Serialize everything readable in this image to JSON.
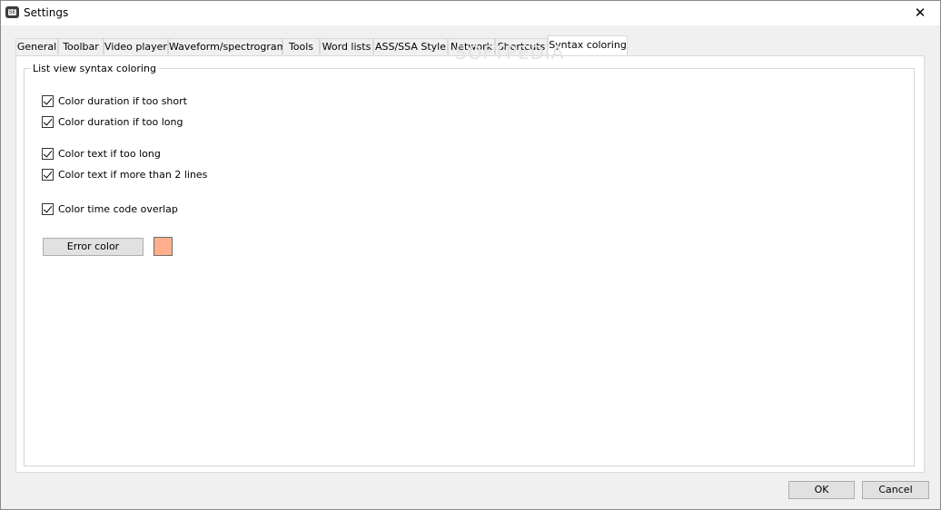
{
  "window": {
    "title": "Settings",
    "close_glyph": "✕",
    "icon": "app-icon"
  },
  "tabs": [
    {
      "label": "General"
    },
    {
      "label": "Toolbar"
    },
    {
      "label": "Video player"
    },
    {
      "label": "Waveform/spectrogram"
    },
    {
      "label": "Tools"
    },
    {
      "label": "Word lists"
    },
    {
      "label": "ASS/SSA Style"
    },
    {
      "label": "Network"
    },
    {
      "label": "Shortcuts"
    },
    {
      "label": "Syntax coloring",
      "active": true
    }
  ],
  "group": {
    "title": "List view syntax coloring",
    "checks": [
      {
        "label": "Color duration if too short",
        "checked": true
      },
      {
        "label": "Color duration if too long",
        "checked": true
      },
      {
        "label": "Color text if too long",
        "checked": true
      },
      {
        "label": "Color text if more than 2 lines",
        "checked": true
      },
      {
        "label": "Color time code overlap",
        "checked": true
      }
    ],
    "error_color_label": "Error color",
    "error_color": "#ffaf8c"
  },
  "footer": {
    "ok_label": "OK",
    "cancel_label": "Cancel"
  },
  "watermark": "SOFTPEDIA"
}
